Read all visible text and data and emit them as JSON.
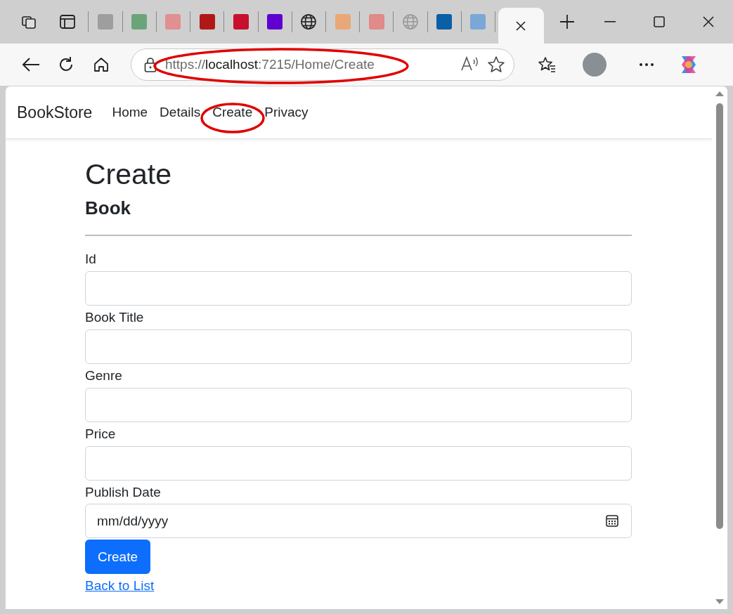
{
  "browser": {
    "tabs": [
      {
        "kind": "workspaces"
      },
      {
        "kind": "tab-actions"
      },
      {
        "kind": "favicon",
        "color": "#9e9e9e",
        "selected": false
      },
      {
        "kind": "favicon",
        "color": "#6aa57a",
        "selected": false
      },
      {
        "kind": "favicon",
        "color": "#e09090",
        "selected": false
      },
      {
        "kind": "favicon",
        "color": "#b01818",
        "selected": false
      },
      {
        "kind": "favicon",
        "color": "#c8102e",
        "selected": false
      },
      {
        "kind": "favicon",
        "color": "#6001d2",
        "selected": false
      },
      {
        "kind": "globe",
        "color": "#202020",
        "selected": false
      },
      {
        "kind": "favicon",
        "color": "#e8a878",
        "selected": false
      },
      {
        "kind": "favicon",
        "color": "#e08a8a",
        "selected": false
      },
      {
        "kind": "globe",
        "color": "#9a9a9a",
        "selected": false
      },
      {
        "kind": "favicon",
        "color": "#0b5fa5",
        "selected": false
      },
      {
        "kind": "favicon",
        "color": "#7aa7d8",
        "selected": false
      },
      {
        "kind": "close",
        "selected": true
      }
    ],
    "address": {
      "prefix": "https://",
      "host": "localhost",
      "suffix": ":7215/Home/Create",
      "circled": true
    }
  },
  "navbar": {
    "brand": "BookStore",
    "items": [
      {
        "label": "Home",
        "circled": false
      },
      {
        "label": "Details",
        "circled": false
      },
      {
        "label": "Create",
        "circled": true
      },
      {
        "label": "Privacy",
        "circled": false
      }
    ]
  },
  "page": {
    "title": "Create",
    "subtitle": "Book",
    "fields": [
      {
        "label": "Id",
        "kind": "text"
      },
      {
        "label": "Book Title",
        "kind": "text"
      },
      {
        "label": "Genre",
        "kind": "text"
      },
      {
        "label": "Price",
        "kind": "text"
      },
      {
        "label": "Publish Date",
        "kind": "date",
        "placeholder": "mm/dd/yyyy"
      }
    ],
    "submit": "Create",
    "back_link": "Back to List"
  }
}
